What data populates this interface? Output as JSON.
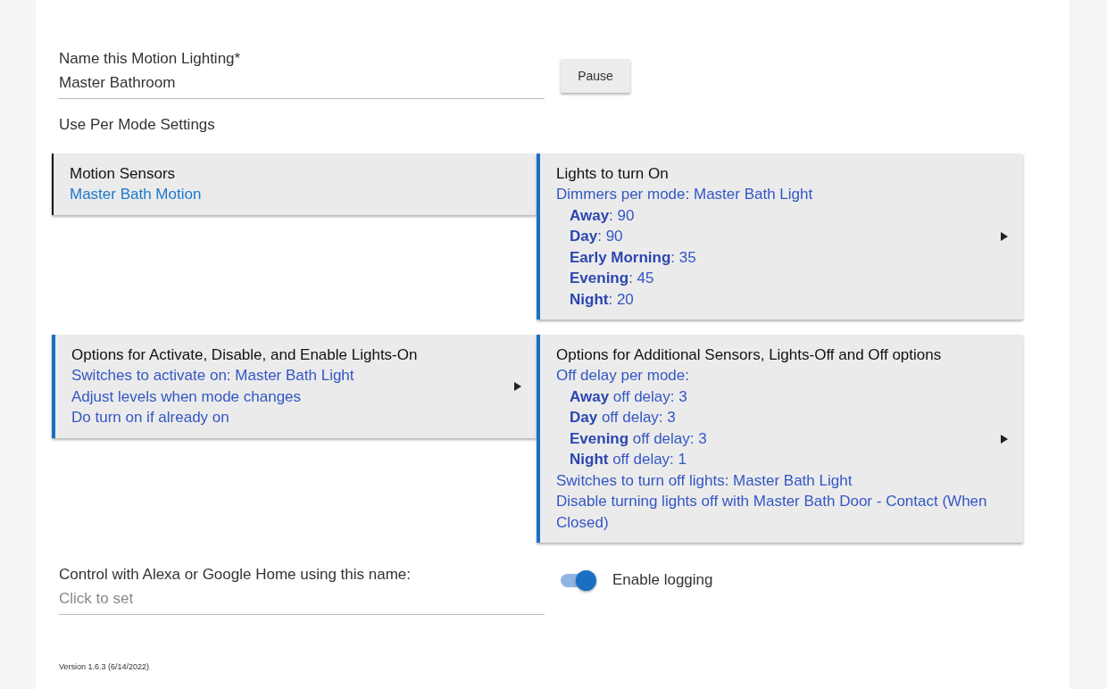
{
  "name_field": {
    "label": "Name this Motion Lighting*",
    "value": "Master Bathroom"
  },
  "pause_button": "Pause",
  "per_mode_label": "Use Per Mode Settings",
  "cards": [
    {
      "title": "Motion Sensors",
      "expandable": false,
      "lines": [
        {
          "text": "Master Bath Motion"
        }
      ]
    },
    {
      "title": "Lights to turn On",
      "expandable": true,
      "lines": [
        {
          "text": "Dimmers per mode: Master Bath Light",
          "children": [
            {
              "text": "**Away**: 90"
            },
            {
              "text": "**Day**: 90"
            },
            {
              "text": "**Early Morning**: 35"
            },
            {
              "text": "**Evening**: 45"
            },
            {
              "text": "**Night**: 20"
            }
          ]
        }
      ]
    },
    {
      "title": "Options for Activate, Disable, and Enable Lights-On",
      "expandable": true,
      "lines": [
        {
          "text": "Switches to activate on: Master Bath Light"
        },
        {
          "text": "Adjust levels when mode changes"
        },
        {
          "text": "Do turn on if already on"
        }
      ]
    },
    {
      "title": "Options for Additional Sensors, Lights-Off and Off options",
      "expandable": true,
      "lines": [
        {
          "text": "Off delay per mode:",
          "children": [
            {
              "text": "**Away** off delay: 3"
            },
            {
              "text": "**Day** off delay: 3"
            },
            {
              "text": "**Evening** off delay: 3"
            },
            {
              "text": "**Night** off delay: 1"
            }
          ]
        },
        {
          "text": "Switches to turn off lights: Master Bath Light"
        },
        {
          "text": "Disable turning lights off with Master Bath Door - Contact (When Closed)"
        }
      ]
    }
  ],
  "alexa_field": {
    "label": "Control with Alexa or Google Home using this name:",
    "placeholder": "Click to set"
  },
  "logging": {
    "label": "Enable logging",
    "on": true
  },
  "version": "Version 1.6.3 (6/14/2022)"
}
